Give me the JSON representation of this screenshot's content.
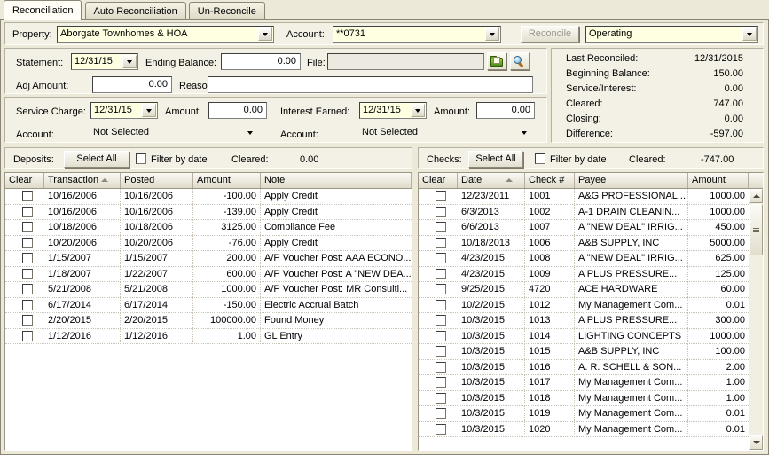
{
  "window": {
    "tabs": [
      {
        "label": "Reconciliation",
        "active": true
      },
      {
        "label": "Auto Reconciliation",
        "active": false
      },
      {
        "label": "Un-Reconcile",
        "active": false
      }
    ]
  },
  "property_row": {
    "property_label": "Property:",
    "property_value": "Aborgate Townhomes & HOA",
    "account_label": "Account:",
    "account_value": "**0731",
    "reconcile_button": "Reconcile",
    "reconcile_enabled": false,
    "bank_account_value": "Operating"
  },
  "statement": {
    "statement_label": "Statement:",
    "statement_date": "12/31/15",
    "ending_balance_label": "Ending Balance:",
    "ending_balance_value": "0.00",
    "file_label": "File:",
    "file_value": "",
    "folder_icon": "folder-open-icon",
    "search_icon": "magnifier-icon",
    "adj_amount_label": "Adj Amount:",
    "adj_amount_value": "0.00",
    "reason_label": "Reason:",
    "reason_value": ""
  },
  "charges": {
    "service_charge_label": "Service Charge:",
    "service_charge_date": "12/31/15",
    "service_amount_label": "Amount:",
    "service_amount_value": "0.00",
    "service_account_label": "Account:",
    "service_account_value": "Not Selected",
    "interest_label": "Interest Earned:",
    "interest_date": "12/31/15",
    "interest_amount_label": "Amount:",
    "interest_amount_value": "0.00",
    "interest_account_label": "Account:",
    "interest_account_value": "Not Selected"
  },
  "summary": {
    "rows": [
      {
        "key": "Last Reconciled:",
        "value": "12/31/2015"
      },
      {
        "key": "Beginning Balance:",
        "value": "150.00"
      },
      {
        "key": "Service/Interest:",
        "value": "0.00"
      },
      {
        "key": "Cleared:",
        "value": "747.00"
      },
      {
        "key": "Closing:",
        "value": "0.00"
      },
      {
        "key": "Difference:",
        "value": "-597.00"
      }
    ]
  },
  "deposits": {
    "title": "Deposits:",
    "select_all": "Select All",
    "filter_label": "Filter by date",
    "filter_checked": false,
    "cleared_label": "Cleared:",
    "cleared_value": "0.00",
    "columns": [
      "Clear",
      "Transaction",
      "Posted",
      "Amount",
      "Note"
    ],
    "sort_column": "Transaction",
    "sort_dir": "asc",
    "rows": [
      {
        "clear": false,
        "transaction": "10/16/2006",
        "posted": "10/16/2006",
        "amount": "-100.00",
        "note": "Apply Credit"
      },
      {
        "clear": false,
        "transaction": "10/16/2006",
        "posted": "10/16/2006",
        "amount": "-139.00",
        "note": "Apply Credit"
      },
      {
        "clear": false,
        "transaction": "10/18/2006",
        "posted": "10/18/2006",
        "amount": "3125.00",
        "note": "Compliance Fee"
      },
      {
        "clear": false,
        "transaction": "10/20/2006",
        "posted": "10/20/2006",
        "amount": "-76.00",
        "note": "Apply Credit"
      },
      {
        "clear": false,
        "transaction": "1/15/2007",
        "posted": "1/15/2007",
        "amount": "200.00",
        "note": "A/P Voucher Post: AAA  ECONO..."
      },
      {
        "clear": false,
        "transaction": "1/18/2007",
        "posted": "1/22/2007",
        "amount": "600.00",
        "note": "A/P Voucher Post: A \"NEW DEA..."
      },
      {
        "clear": false,
        "transaction": "5/21/2008",
        "posted": "5/21/2008",
        "amount": "1000.00",
        "note": "A/P Voucher Post: MR  Consulti..."
      },
      {
        "clear": false,
        "transaction": "6/17/2014",
        "posted": "6/17/2014",
        "amount": "-150.00",
        "note": "Electric Accrual Batch"
      },
      {
        "clear": false,
        "transaction": "2/20/2015",
        "posted": "2/20/2015",
        "amount": "100000.00",
        "note": "Found Money"
      },
      {
        "clear": false,
        "transaction": "1/12/2016",
        "posted": "1/12/2016",
        "amount": "1.00",
        "note": "GL Entry"
      }
    ]
  },
  "checks": {
    "title": "Checks:",
    "select_all": "Select All",
    "filter_label": "Filter by date",
    "filter_checked": false,
    "cleared_label": "Cleared:",
    "cleared_value": "-747.00",
    "columns": [
      "Clear",
      "Date",
      "Check #",
      "Payee",
      "Amount"
    ],
    "sort_column": "Date",
    "sort_dir": "asc",
    "rows": [
      {
        "clear": false,
        "date": "12/23/2011",
        "check": "1001",
        "payee": "A&G PROFESSIONAL...",
        "amount": "1000.00"
      },
      {
        "clear": false,
        "date": "6/3/2013",
        "check": "1002",
        "payee": "A-1 DRAIN CLEANIN...",
        "amount": "1000.00"
      },
      {
        "clear": false,
        "date": "6/6/2013",
        "check": "1007",
        "payee": "A \"NEW DEAL\" IRRIG...",
        "amount": "450.00"
      },
      {
        "clear": false,
        "date": "10/18/2013",
        "check": "1006",
        "payee": "A&B SUPPLY, INC",
        "amount": "5000.00"
      },
      {
        "clear": false,
        "date": "4/23/2015",
        "check": "1008",
        "payee": "A \"NEW DEAL\" IRRIG...",
        "amount": "625.00"
      },
      {
        "clear": false,
        "date": "4/23/2015",
        "check": "1009",
        "payee": "A PLUS PRESSURE...",
        "amount": "125.00"
      },
      {
        "clear": false,
        "date": "9/25/2015",
        "check": "4720",
        "payee": "ACE HARDWARE",
        "amount": "60.00"
      },
      {
        "clear": false,
        "date": "10/2/2015",
        "check": "1012",
        "payee": "My Management Com...",
        "amount": "0.01"
      },
      {
        "clear": false,
        "date": "10/3/2015",
        "check": "1013",
        "payee": "A PLUS PRESSURE...",
        "amount": "300.00"
      },
      {
        "clear": false,
        "date": "10/3/2015",
        "check": "1014",
        "payee": "LIGHTING CONCEPTS",
        "amount": "1000.00"
      },
      {
        "clear": false,
        "date": "10/3/2015",
        "check": "1015",
        "payee": "A&B SUPPLY, INC",
        "amount": "100.00"
      },
      {
        "clear": false,
        "date": "10/3/2015",
        "check": "1016",
        "payee": "A. R. SCHELL & SON...",
        "amount": "2.00"
      },
      {
        "clear": false,
        "date": "10/3/2015",
        "check": "1017",
        "payee": "My Management Com...",
        "amount": "1.00"
      },
      {
        "clear": false,
        "date": "10/3/2015",
        "check": "1018",
        "payee": "My Management Com...",
        "amount": "1.00"
      },
      {
        "clear": false,
        "date": "10/3/2015",
        "check": "1019",
        "payee": "My Management Com...",
        "amount": "0.01"
      },
      {
        "clear": false,
        "date": "10/3/2015",
        "check": "1020",
        "payee": "My Management Com...",
        "amount": "0.01"
      }
    ]
  },
  "colors": {
    "window_bg": "#ece9d8",
    "field_yellow": "#ffffe1",
    "tab_active": "#fffdf6",
    "border": "#8a8577"
  }
}
